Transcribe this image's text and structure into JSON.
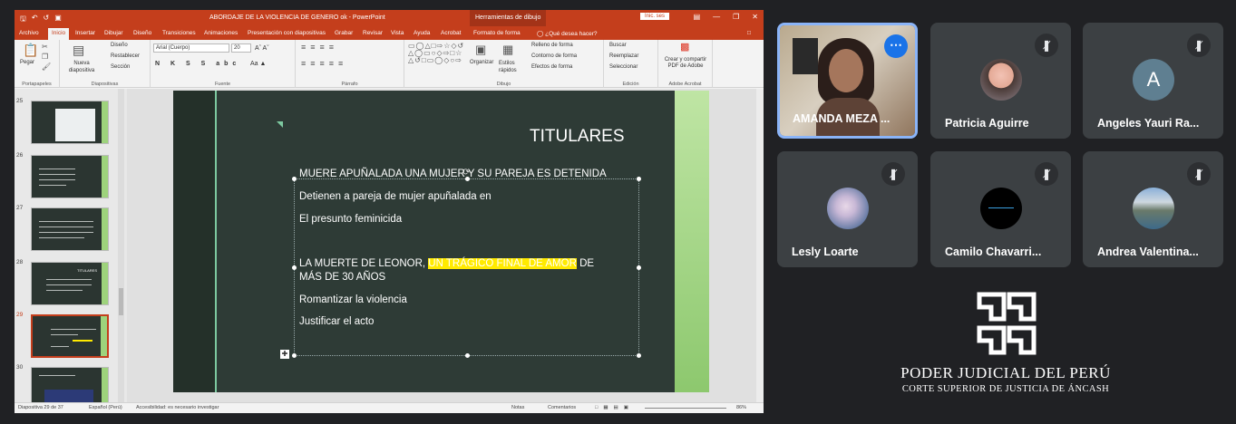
{
  "ppt": {
    "window_title": "ABORDAJE DE LA VIOLENCIA DE GENERO ok  -  PowerPoint",
    "context_tab": "Herramientas de dibujo",
    "sign_in": "Inic. ses",
    "tabs": [
      "Archivo",
      "Inicio",
      "Insertar",
      "Dibujar",
      "Diseño",
      "Transiciones",
      "Animaciones",
      "Presentación con diapositivas",
      "Grabar",
      "Revisar",
      "Vista",
      "Ayuda",
      "Acrobat",
      "Formato de forma"
    ],
    "tell_me": "¿Qué desea hacer?",
    "ribbon": {
      "paste": "Pegar",
      "new_slide": "Nueva diapositiva",
      "design": "Diseño",
      "reset": "Restablecer",
      "section": "Sección",
      "font_name": "Arial (Cuerpo)",
      "font_size": "20",
      "arrange": "Organizar",
      "quick_styles": "Estilos rápidos",
      "fill": "Relleno de forma",
      "outline": "Contorno de forma",
      "effects": "Efectos de forma",
      "find": "Buscar",
      "replace": "Reemplazar",
      "select": "Seleccionar",
      "adobe": "Crear y compartir PDF de Adobe",
      "groups": [
        "Portapapeles",
        "Diapositivas",
        "Fuente",
        "Párrafo",
        "Dibujo",
        "Edición",
        "Adobe Acrobat"
      ]
    },
    "thumbnails": [
      {
        "num": "25"
      },
      {
        "num": "26"
      },
      {
        "num": "27"
      },
      {
        "num": "28",
        "title": "TITULARES"
      },
      {
        "num": "29"
      },
      {
        "num": "30"
      }
    ],
    "slide": {
      "title": "TITULARES",
      "lines": [
        "MUERE APUÑALADA UNA MUJER Y SU PAREJA ES DETENIDA",
        "Detienen a pareja de mujer apuñalada en",
        "El presunto feminicida"
      ],
      "leonor_pre": "LA MUERTE DE LEONOR, ",
      "leonor_hl": "UN TRÁGICO FINAL DE AMOR",
      "leonor_post": " DE",
      "leonor_line2": "MÁS DE 30 AÑOS",
      "lines2": [
        "Romantizar la violencia",
        "Justificar el acto"
      ]
    },
    "status": {
      "slide_count": "Diapositiva 29 de 37",
      "language": "Español (Perú)",
      "accessibility": "Accesibilidad: es necesario investigar",
      "notes": "Notas",
      "comments": "Comentarios",
      "zoom": "86%"
    }
  },
  "participants": [
    {
      "name": "AMANDA MEZA ..."
    },
    {
      "name": "Patricia Aguirre"
    },
    {
      "name": "Angeles Yauri Ra...",
      "initial": "A"
    },
    {
      "name": "Lesly Loarte"
    },
    {
      "name": "Camilo Chavarri..."
    },
    {
      "name": "Andrea Valentina..."
    }
  ],
  "colors": {
    "accent": "#c43e1c",
    "meet_tile": "#3c4043",
    "highlight": "#ffea00",
    "avatar_a": "#5f7f91"
  },
  "org": {
    "line1": "PODER JUDICIAL DEL PERÚ",
    "line2": "CORTE SUPERIOR DE JUSTICIA DE ÁNCASH"
  }
}
